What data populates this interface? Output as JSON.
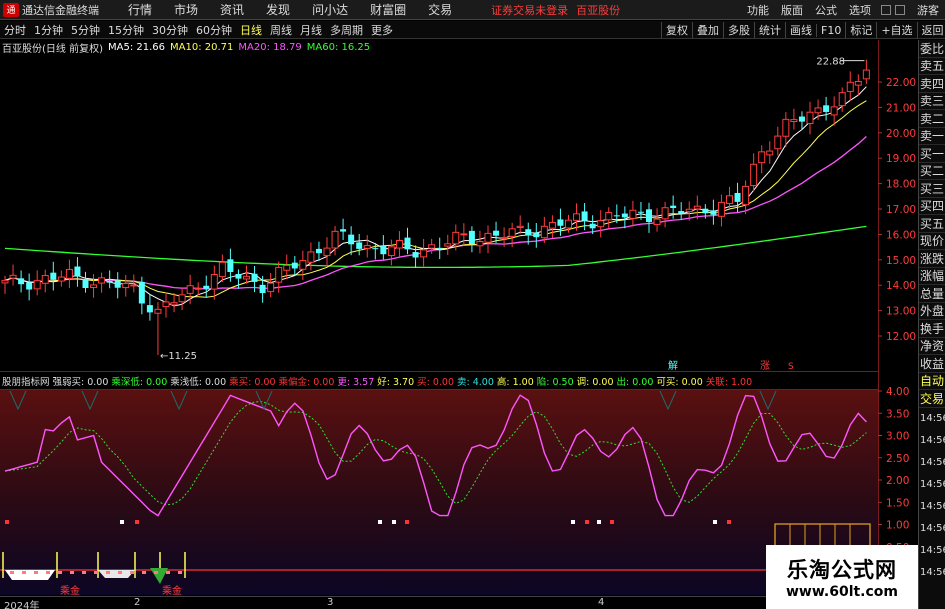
{
  "topbar": {
    "app_title": "通达信金融终端",
    "menu": [
      "行情",
      "市场",
      "资讯",
      "发现",
      "问小达",
      "财富圈",
      "交易"
    ],
    "notice": "证券交易未登录",
    "stock_name": "百亚股份",
    "right_menu": [
      "功能",
      "版面",
      "公式",
      "选项"
    ],
    "guest": "游客"
  },
  "periodbar": {
    "periods": [
      "分时",
      "1分钟",
      "5分钟",
      "15分钟",
      "30分钟",
      "60分钟",
      "日线",
      "周线",
      "月线",
      "多周期",
      "更多"
    ],
    "active": "日线",
    "tools": [
      "复权",
      "叠加",
      "多股",
      "统计",
      "画线",
      "F10",
      "标记",
      "+自选",
      "返回"
    ]
  },
  "main_header": {
    "title": "百亚股份(日线 前复权)",
    "ma5": "MA5: 21.66",
    "ma10": "MA10: 20.71",
    "ma20": "MA20: 18.79",
    "ma60": "MA60: 16.25"
  },
  "price_axis": {
    "ticks": [
      "22.00",
      "21.00",
      "20.00",
      "19.00",
      "18.00",
      "17.00",
      "16.00",
      "15.00",
      "14.00",
      "13.00",
      "12.00"
    ],
    "high_label": "22.88",
    "low_label": "11.25"
  },
  "markers": {
    "jie": "解",
    "zhang": "涨",
    "s": "S"
  },
  "sub_header": {
    "name": "股朋指标网",
    "items": [
      {
        "label": "强弱买: 0.00",
        "color": "#dddddd"
      },
      {
        "label": "乘深低: 0.00",
        "color": "#33ff33"
      },
      {
        "label": "乘浅低: 0.00",
        "color": "#dddddd"
      },
      {
        "label": "乘买: 0.00",
        "color": "#ff3333"
      },
      {
        "label": "乘偏金: 0.00",
        "color": "#ff3333"
      },
      {
        "label": "更: 3.57",
        "color": "#ff55ff"
      },
      {
        "label": "好: 3.70",
        "color": "#ffff55"
      },
      {
        "label": "买: 0.00",
        "color": "#ff3333"
      },
      {
        "label": "卖: 4.00",
        "color": "#33dddd"
      },
      {
        "label": "高: 1.00",
        "color": "#ffff55"
      },
      {
        "label": "陷: 0.50",
        "color": "#33ff33"
      },
      {
        "label": "调: 0.00",
        "color": "#ffff55"
      },
      {
        "label": "出: 0.00",
        "color": "#33ff33"
      },
      {
        "label": "可买: 0.00",
        "color": "#ffff55"
      },
      {
        "label": "关联: 1.00",
        "color": "#ff3333"
      }
    ]
  },
  "sub_axis": {
    "ticks": [
      "4.00",
      "3.50",
      "3.00",
      "2.50",
      "2.00",
      "1.50",
      "1.00",
      "0.50"
    ]
  },
  "sub_labels": {
    "cheng_jin_1": "乘金",
    "cheng_jin_2": "乘金"
  },
  "date_axis": {
    "labels": [
      "2024年",
      "2",
      "3",
      "4"
    ]
  },
  "right_panel": {
    "items": [
      "委比",
      "卖五",
      "卖四",
      "卖三",
      "卖二",
      "卖一",
      "买一",
      "买二",
      "买三",
      "买四",
      "买五",
      "现价",
      "涨跌",
      "涨幅",
      "总量",
      "外盘",
      "换手",
      "净资",
      "收益"
    ],
    "bottom": [
      "自动",
      "交易"
    ],
    "times": [
      "14:56",
      "14:56",
      "14:56",
      "14:56",
      "14:56",
      "14:56",
      "14:56",
      "14:56"
    ]
  },
  "watermark": {
    "title": "乐淘公式网",
    "url": "www.60lt.com"
  },
  "colors": {
    "up": "#ff3c3c",
    "down": "#54ffff",
    "ma5": "#ffffff",
    "ma10": "#ffff55",
    "ma20": "#ff55ff",
    "ma60": "#33ff33"
  }
}
